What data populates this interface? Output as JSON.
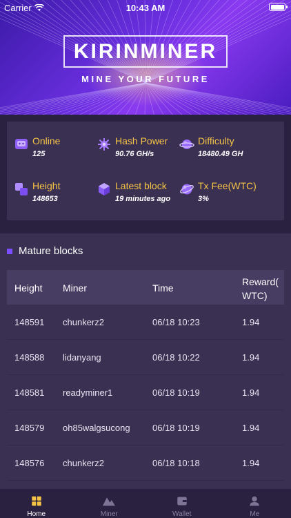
{
  "status_bar": {
    "carrier": "Carrier",
    "time": "10:43 AM"
  },
  "banner": {
    "logo": "KIRINMINER",
    "tagline": "MINE YOUR FUTURE"
  },
  "stats": [
    {
      "label": "Online",
      "value": "125",
      "icon": "online-icon"
    },
    {
      "label": "Hash Power",
      "value": "90.76 GH/s",
      "icon": "hash-power-icon"
    },
    {
      "label": "Difficulty",
      "value": "18480.49 GH",
      "icon": "difficulty-icon"
    },
    {
      "label": "Height",
      "value": "148653",
      "icon": "height-icon"
    },
    {
      "label": "Latest block",
      "value": "19 minutes ago",
      "icon": "latest-block-icon"
    },
    {
      "label": "Tx Fee(WTC)",
      "value": "3%",
      "icon": "tx-fee-icon"
    }
  ],
  "mature": {
    "title": "Mature blocks",
    "columns": [
      "Height",
      "Miner",
      "Time",
      "Reward(\nWTC)"
    ],
    "rows": [
      {
        "height": "148591",
        "miner": "chunkerz2",
        "time": "06/18 10:23",
        "reward": "1.94"
      },
      {
        "height": "148588",
        "miner": "lidanyang",
        "time": "06/18 10:22",
        "reward": "1.94"
      },
      {
        "height": "148581",
        "miner": "readyminer1",
        "time": "06/18 10:19",
        "reward": "1.94"
      },
      {
        "height": "148579",
        "miner": "oh85walgsucong",
        "time": "06/18 10:19",
        "reward": "1.94"
      },
      {
        "height": "148576",
        "miner": "chunkerz2",
        "time": "06/18 10:18",
        "reward": "1.94"
      }
    ]
  },
  "tabs": [
    {
      "label": "Home",
      "icon": "home-icon",
      "active": true
    },
    {
      "label": "Miner",
      "icon": "miner-icon",
      "active": false
    },
    {
      "label": "Wallet",
      "icon": "wallet-icon",
      "active": false
    },
    {
      "label": "Me",
      "icon": "me-icon",
      "active": false
    }
  ],
  "colors": {
    "accent": "#7b4dff",
    "stat_label": "#f5c346",
    "panel": "#3a3152",
    "background": "#2a2140"
  }
}
